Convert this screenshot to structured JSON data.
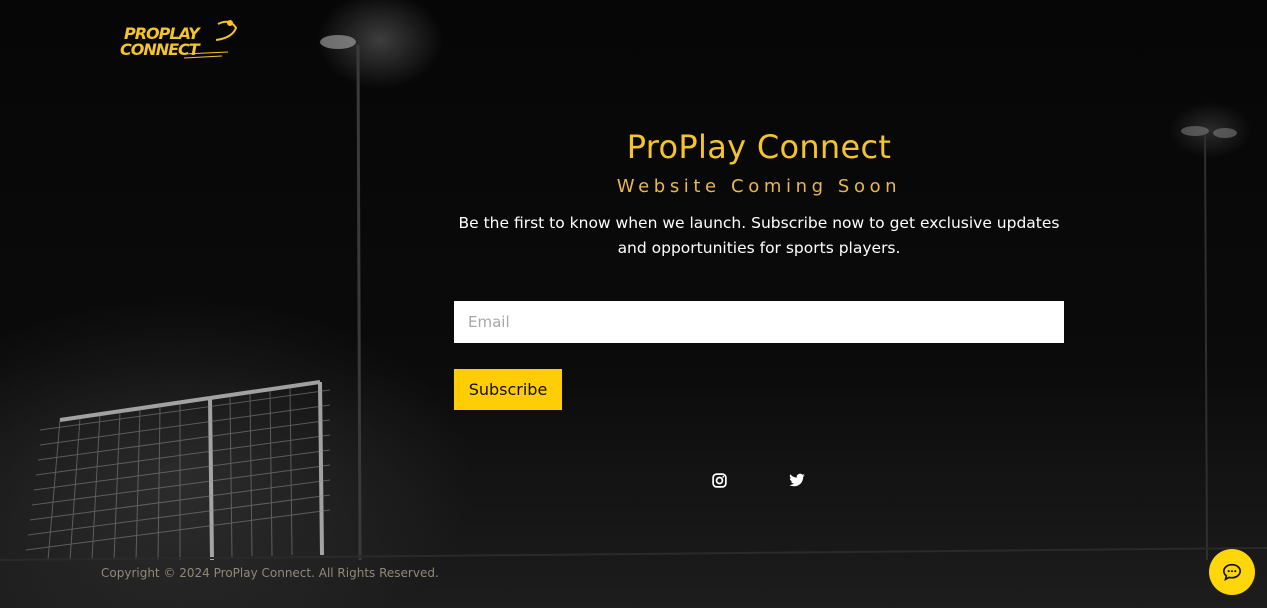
{
  "brand": {
    "logo_line1": "PROPLAY",
    "logo_line2": "CONNECT",
    "accent_color": "#f5c32c"
  },
  "hero": {
    "title": "ProPlay Connect",
    "subtitle": "Website Coming Soon",
    "description": "Be the first to know when we launch. Subscribe now to get exclusive updates and opportunities for sports players."
  },
  "form": {
    "email_placeholder": "Email",
    "email_value": "",
    "subscribe_label": "Subscribe"
  },
  "social": {
    "instagram": "instagram-icon",
    "twitter": "twitter-icon"
  },
  "footer": {
    "copyright": "Copyright © 2024 ProPlay Connect. All Rights Reserved."
  },
  "chat": {
    "icon": "chat-bubble-icon"
  }
}
